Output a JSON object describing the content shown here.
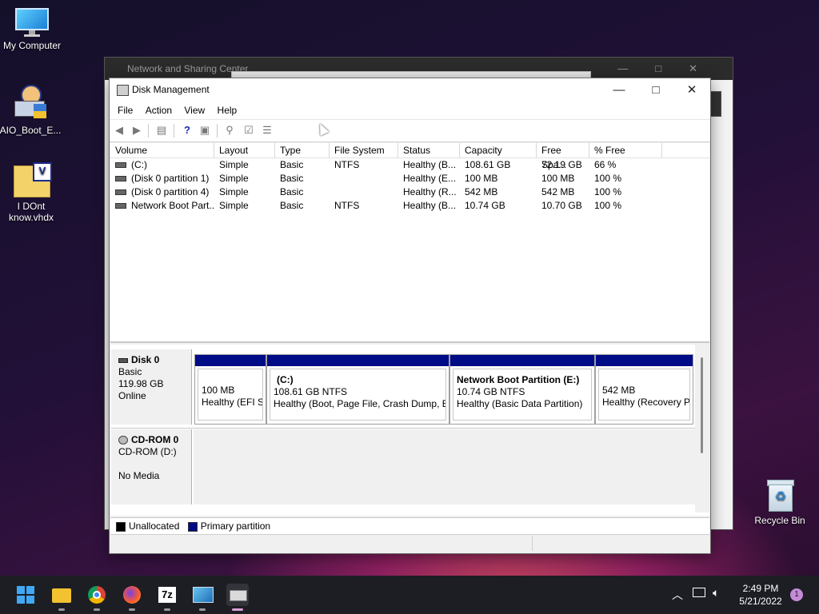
{
  "desktop": {
    "icons": [
      {
        "label": "My Computer"
      },
      {
        "label": "AIO_Boot_E..."
      },
      {
        "label": "I DOnt know.vhdx"
      },
      {
        "label": "Recycle Bin"
      }
    ]
  },
  "background_window": {
    "title": "Network and Sharing Center"
  },
  "window": {
    "title": "Disk Management",
    "menu": [
      "File",
      "Action",
      "View",
      "Help"
    ],
    "columns": [
      "Volume",
      "Layout",
      "Type",
      "File System",
      "Status",
      "Capacity",
      "Free Spa...",
      "% Free"
    ],
    "rows": [
      [
        "(C:)",
        "Simple",
        "Basic",
        "NTFS",
        "Healthy (B...",
        "108.61 GB",
        "72.19 GB",
        "66 %"
      ],
      [
        "(Disk 0 partition 1)",
        "Simple",
        "Basic",
        "",
        "Healthy (E...",
        "100 MB",
        "100 MB",
        "100 %"
      ],
      [
        "(Disk 0 partition 4)",
        "Simple",
        "Basic",
        "",
        "Healthy (R...",
        "542 MB",
        "542 MB",
        "100 %"
      ],
      [
        "Network Boot Part...",
        "Simple",
        "Basic",
        "NTFS",
        "Healthy (B...",
        "10.74 GB",
        "10.70 GB",
        "100 %"
      ]
    ],
    "disk0": {
      "name": "Disk 0",
      "type": "Basic",
      "size": "119.98 GB",
      "state": "Online",
      "partitions": [
        {
          "name": "",
          "size": "100 MB",
          "status": "Healthy (EFI Sy"
        },
        {
          "name": "(C:)",
          "size": "108.61 GB NTFS",
          "status": "Healthy (Boot, Page File, Crash Dump, B"
        },
        {
          "name": "Network Boot Partition  (E:)",
          "size": "10.74 GB NTFS",
          "status": "Healthy (Basic Data Partition)"
        },
        {
          "name": "",
          "size": "542 MB",
          "status": "Healthy (Recovery Pa"
        }
      ]
    },
    "cdrom0": {
      "name": "CD-ROM 0",
      "drive": "CD-ROM (D:)",
      "media": "No Media"
    },
    "legend": {
      "unallocated": "Unallocated",
      "primary": "Primary partition"
    },
    "colors": {
      "primary": "#000b86",
      "unallocated": "#000000"
    }
  },
  "taskbar": {
    "time": "2:49 PM",
    "date": "5/21/2022",
    "notifications": "1",
    "apps": [
      "start-icon",
      "file-explorer-icon",
      "chrome-icon",
      "firefox-icon",
      "7zip-icon",
      "control-panel-icon",
      "disk-management-icon"
    ]
  }
}
